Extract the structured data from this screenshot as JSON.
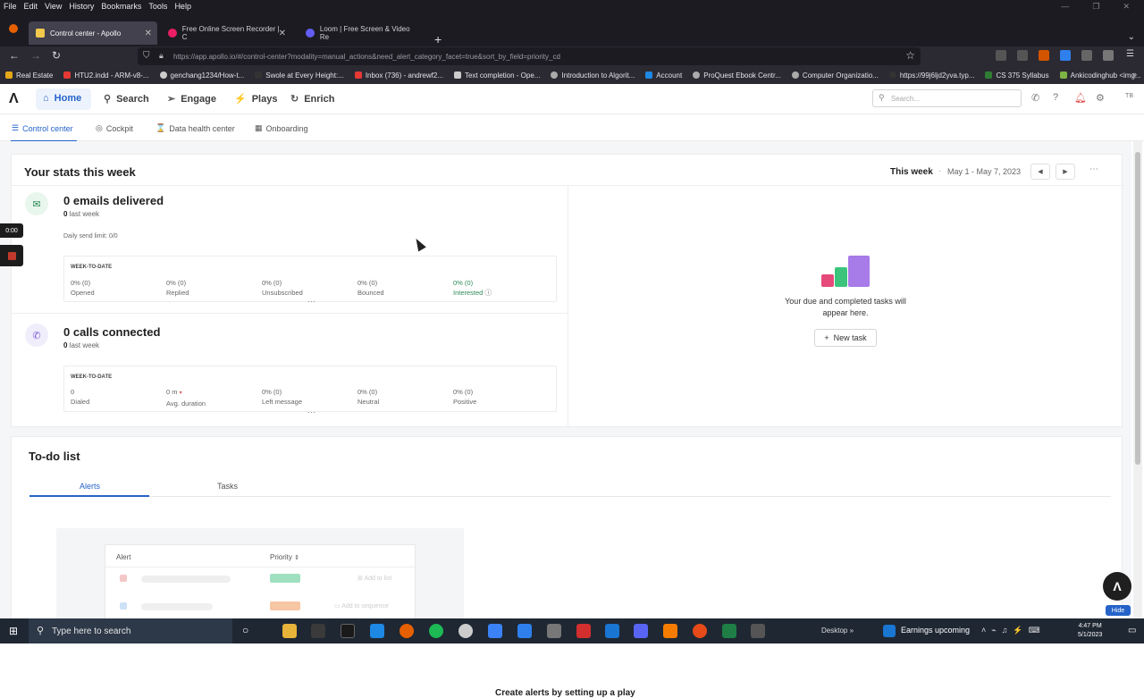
{
  "menubar": {
    "items": [
      "File",
      "Edit",
      "View",
      "History",
      "Bookmarks",
      "Tools",
      "Help"
    ]
  },
  "browser_tabs": [
    {
      "title": "Control center - Apollo",
      "icon_color": "#f2c94c",
      "active": true
    },
    {
      "title": "Free Online Screen Recorder | C",
      "icon_color": "#e91e63",
      "active": false
    },
    {
      "title": "Loom | Free Screen & Video Re",
      "icon_color": "#625df5",
      "active": false
    }
  ],
  "url": "https://app.apollo.io/#/control-center?modality=manual_actions&need_alert_category_facet=true&sort_by_field=priority_cd",
  "bookmarks": [
    {
      "label": "Real Estate",
      "color": "#e6a817"
    },
    {
      "label": "HTU2.indd - ARM-v8-...",
      "color": "#e53935"
    },
    {
      "label": "genchang1234/How-t...",
      "color": "#cccccc"
    },
    {
      "label": "Swole at Every Height:...",
      "color": "#333333"
    },
    {
      "label": "Inbox (736) - andrewf2...",
      "color": "#e53935"
    },
    {
      "label": "Text completion - Ope...",
      "color": "#cccccc"
    },
    {
      "label": "Introduction to Algorit...",
      "color": "#aaaaaa"
    },
    {
      "label": "Account",
      "color": "#1e88e5"
    },
    {
      "label": "ProQuest Ebook Centr...",
      "color": "#aaaaaa"
    },
    {
      "label": "Computer Organizatio...",
      "color": "#aaaaaa"
    },
    {
      "label": "https://99j6ljd2yva.typ...",
      "color": "#333333"
    },
    {
      "label": "CS 375 Syllabus",
      "color": "#2e7d32"
    },
    {
      "label": "Ankicodinghub <img...",
      "color": "#7cb342"
    }
  ],
  "nav": {
    "items": [
      {
        "label": "Home",
        "icon": "home-icon",
        "glyph": "⌂"
      },
      {
        "label": "Search",
        "icon": "search-icon",
        "glyph": "⚲"
      },
      {
        "label": "Engage",
        "icon": "send-icon",
        "glyph": "➢"
      },
      {
        "label": "Plays",
        "icon": "bolt-icon",
        "glyph": "⚡"
      },
      {
        "label": "Enrich",
        "icon": "refresh-icon",
        "glyph": "↻"
      }
    ],
    "search_placeholder": "Search...",
    "avatar": "TB"
  },
  "subnav": {
    "items": [
      {
        "label": "Control center",
        "glyph": "☰"
      },
      {
        "label": "Cockpit",
        "glyph": "◎"
      },
      {
        "label": "Data health center",
        "glyph": "⌛"
      },
      {
        "label": "Onboarding",
        "glyph": "▦"
      }
    ]
  },
  "stats": {
    "title": "Your stats this week",
    "period_label": "This week",
    "date_range": "May 1 - May 7, 2023",
    "emails": {
      "headline": "0 emails delivered",
      "last_week_value": "0",
      "last_week_label": "last week",
      "daily_limit": "Daily send limit: 0/0",
      "wtd_label": "WEEK-TO-DATE",
      "metrics": [
        {
          "value": "0% (0)",
          "label": "Opened"
        },
        {
          "value": "0% (0)",
          "label": "Replied"
        },
        {
          "value": "0% (0)",
          "label": "Unsubscribed"
        },
        {
          "value": "0% (0)",
          "label": "Bounced"
        },
        {
          "value": "0% (0)",
          "label": "Interested"
        }
      ]
    },
    "calls": {
      "headline": "0 calls connected",
      "last_week_value": "0",
      "last_week_label": "last week",
      "wtd_label": "WEEK-TO-DATE",
      "metrics": [
        {
          "value": "0",
          "label": "Dialed"
        },
        {
          "value": "0 m",
          "label": "Avg. duration"
        },
        {
          "value": "0% (0)",
          "label": "Left message"
        },
        {
          "value": "0% (0)",
          "label": "Neutral"
        },
        {
          "value": "0% (0)",
          "label": "Positive"
        }
      ]
    },
    "tasks_empty_text": "Your due and completed tasks will appear here.",
    "new_task_label": "New task"
  },
  "todo": {
    "title": "To-do list",
    "tabs": [
      "Alerts",
      "Tasks"
    ],
    "illustration": {
      "col_alert": "Alert",
      "col_priority": "Priority",
      "add_to_list": "Add to list",
      "add_to_sequence": "Add to sequence"
    },
    "cta": "Create alerts by setting up a play"
  },
  "hide_label": "Hide",
  "recorder_time": "0:00",
  "taskbar": {
    "search_placeholder": "Type here to search",
    "desktop_label": "Desktop",
    "earnings_label": "Earnings upcoming",
    "time": "4:47 PM",
    "date": "5/1/2023"
  },
  "colors": {
    "accent": "#2563c9",
    "positive": "#2e8a57"
  }
}
